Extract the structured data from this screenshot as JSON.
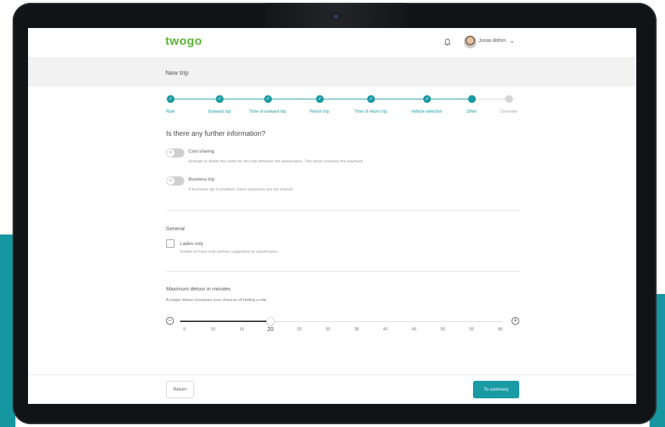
{
  "colors": {
    "accent": "#1a9aa4",
    "brand_green": "#5bb533",
    "frame_accent": "#1696a0"
  },
  "header": {
    "logo": "twogo",
    "user_name": "Jonas Böhm",
    "icons": [
      "bell-icon",
      "avatar",
      "chevron-down-icon"
    ]
  },
  "page": {
    "title": "New trip"
  },
  "stepper": {
    "steps": [
      {
        "label": "Role",
        "state": "done"
      },
      {
        "label": "Outward trip",
        "state": "done"
      },
      {
        "label": "Time of outward trip",
        "state": "done"
      },
      {
        "label": "Return trip",
        "state": "done"
      },
      {
        "label": "Time of return trip",
        "state": "done"
      },
      {
        "label": "Vehicle selection",
        "state": "done"
      },
      {
        "label": "Other",
        "state": "current"
      },
      {
        "label": "Overview",
        "state": "pending"
      }
    ]
  },
  "form": {
    "question": "Is there any further information?",
    "toggles": [
      {
        "label": "Cost sharing",
        "description": "Activate to divide the costs for the ride between the passengers. The driver receives the payment.",
        "on": false
      },
      {
        "label": "Business trip",
        "description": "If business trip is enabled, travel expenses are not shared.",
        "on": false
      }
    ],
    "general": {
      "heading": "General",
      "checkbox_label": "Ladies only",
      "checkbox_description": "Enable to have only women suggested as passengers.",
      "checked": false
    },
    "detour": {
      "heading": "Maximum detour in minutes",
      "description": "A longer detour increases your chances of finding a ride",
      "min": 5,
      "max": 60,
      "value": 20,
      "ticks": [
        "5",
        "10",
        "15",
        "20",
        "25",
        "30",
        "35",
        "40",
        "45",
        "50",
        "55",
        "60"
      ]
    }
  },
  "footer": {
    "return_label": "Return",
    "summary_label": "To summary"
  }
}
